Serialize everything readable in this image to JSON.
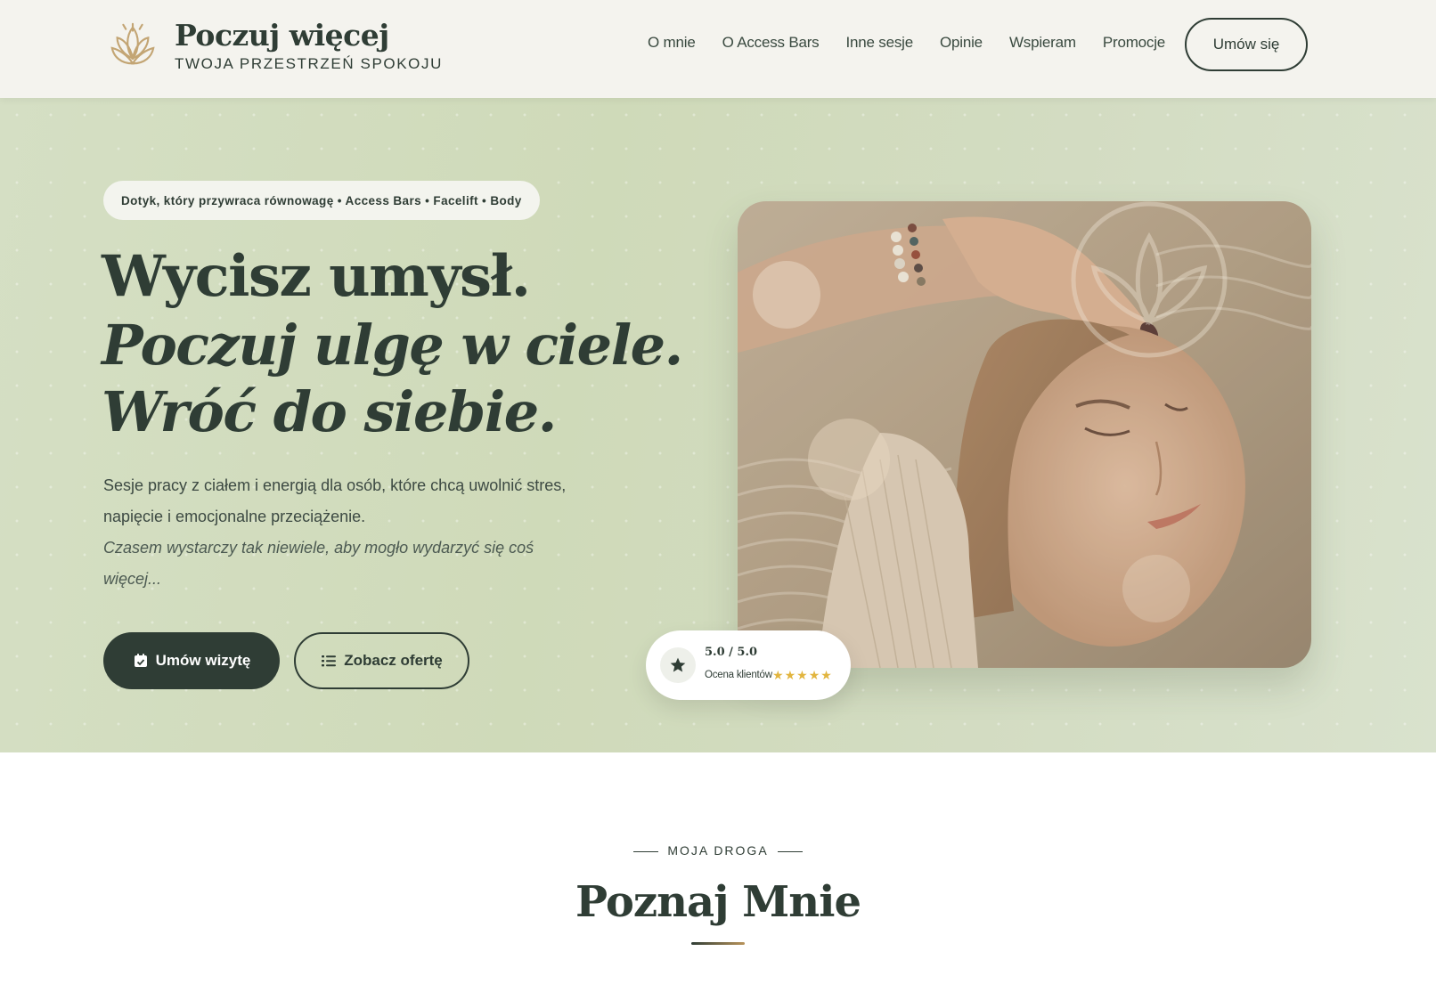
{
  "header": {
    "brand_title": "Poczuj więcej",
    "brand_subtitle": "TWOJA PRZESTRZEŃ SPOKOJU",
    "logo_icon": "lotus-icon",
    "nav": [
      "O mnie",
      "O Access Bars",
      "Inne sesje",
      "Opinie",
      "Wspieram",
      "Promocje"
    ],
    "cta_label": "Umów się"
  },
  "hero": {
    "pill_text": "Dotyk, który przywraca równowagę • Access Bars • Facelift • Body",
    "headline_line1": "Wycisz umysł.",
    "headline_line2": "Poczuj ulgę w ciele.",
    "headline_line3": "Wróć do siebie.",
    "description": "Sesje pracy z ciałem i energią dla osób, które chcą uwolnić stres, napięcie i emocjonalne przeciążenie.",
    "description_italic": "Czasem wystarczy tak niewiele, aby mogło wydarzyć się coś więcej...",
    "primary_button": "Umów wizytę",
    "secondary_button": "Zobacz ofertę",
    "rating": {
      "score": "5.0 / 5.0",
      "label": "Ocena klientów",
      "stars": 5
    }
  },
  "section": {
    "eyebrow": "MOJA DROGA",
    "title": "Poznaj Mnie"
  },
  "colors": {
    "primary": "#2f3d35",
    "hero_bg": "#d1dcbd",
    "header_bg": "#f4f3ee",
    "accent_gold": "#b8935a",
    "star": "#e2b53f"
  }
}
